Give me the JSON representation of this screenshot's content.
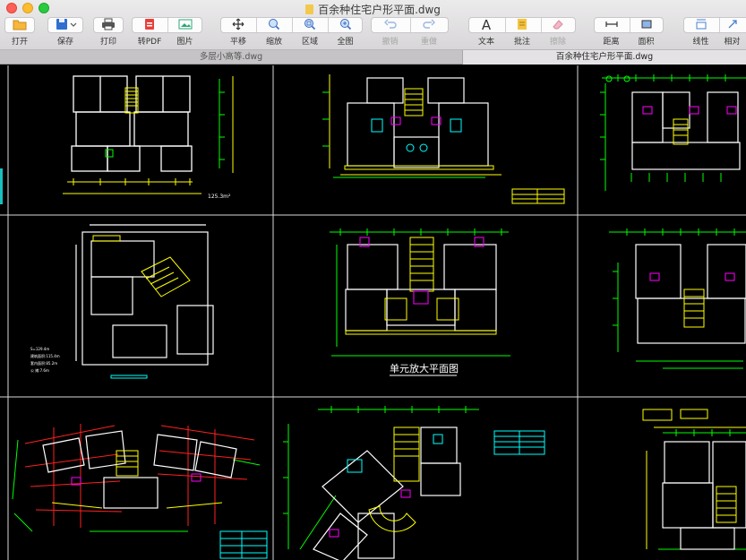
{
  "window": {
    "title": "百余种住宅户形平面.dwg"
  },
  "toolbar": {
    "open": "打开",
    "save": "保存",
    "print": "打印",
    "to_pdf": "转PDF",
    "image": "图片",
    "pan": "平移",
    "zoom": "缩放",
    "region": "区域",
    "fit_all": "全图",
    "undo": "撤销",
    "redo": "重做",
    "text": "文本",
    "annotate": "批注",
    "erase": "擦除",
    "distance": "距离",
    "area": "面积",
    "linear": "线性",
    "relative": "相对"
  },
  "tabs": [
    {
      "label": "多层小高等.dwg"
    },
    {
      "label": "百余种住宅户形平面.dwg"
    }
  ],
  "drawing": {
    "area_note": "125.3m²",
    "area_stats": [
      "S=129.4m",
      "建筑面积:115.4m",
      "套内面积:85.2m",
      "公 摊:7.6m"
    ],
    "unit_title": "单元放大平面图"
  },
  "colors": {
    "accent": "#2f7fe3",
    "cad_white": "#ffffff",
    "cad_yellow": "#ffff00",
    "cad_green": "#00ff00",
    "cad_magenta": "#ff00ff",
    "cad_cyan": "#00ffff",
    "cad_red": "#ff2020"
  },
  "icons": [
    "folder-icon",
    "save-icon",
    "printer-icon",
    "pdf-icon",
    "image-icon",
    "move-icon",
    "zoom-icon",
    "region-zoom-icon",
    "fit-icon",
    "undo-icon",
    "redo-icon",
    "text-icon",
    "annotation-icon",
    "eraser-icon",
    "distance-icon",
    "area-icon",
    "linear-icon",
    "relative-icon"
  ]
}
